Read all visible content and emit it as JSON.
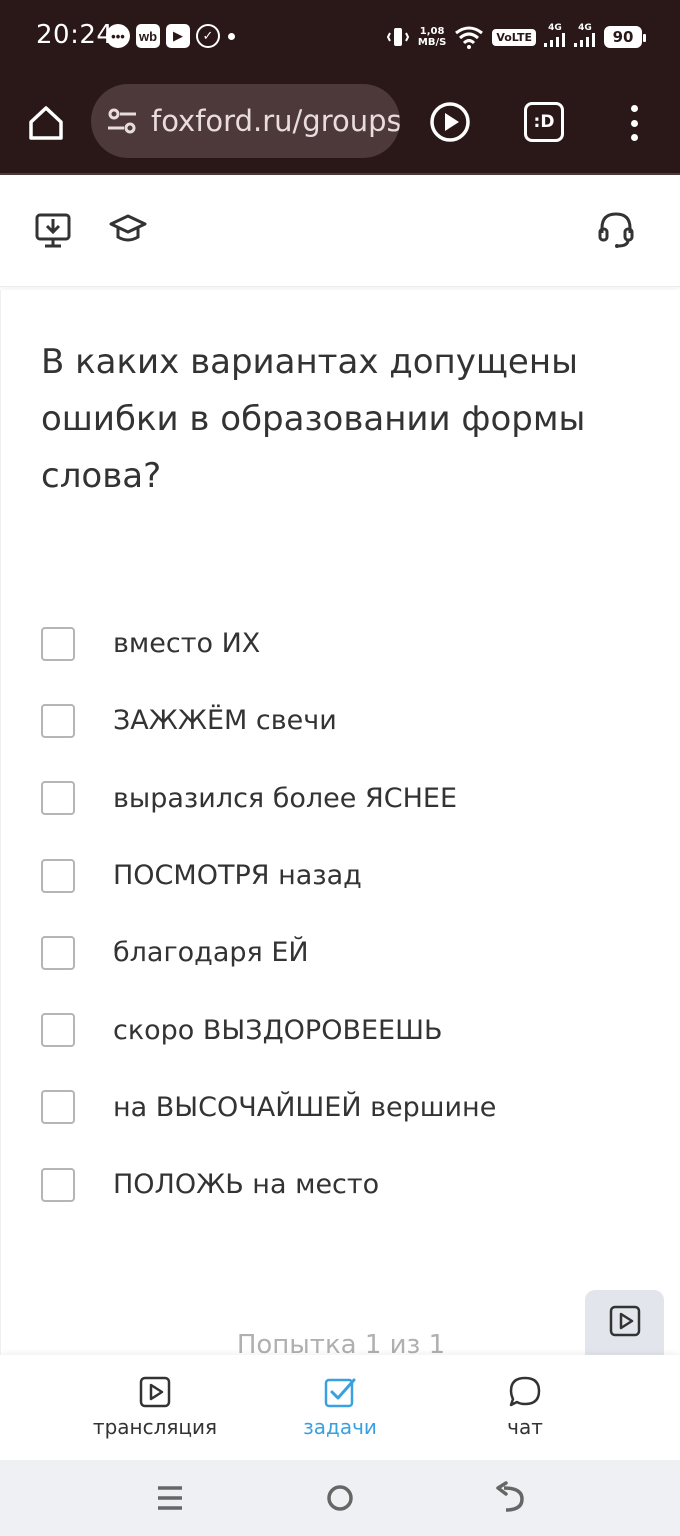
{
  "status_bar": {
    "time": "20:24",
    "left_icons": [
      "chat-bubble-icon",
      "wb-icon",
      "youtube-icon",
      "check-circle-icon"
    ],
    "net_speed_value": "1,08",
    "net_speed_unit": "MB/S",
    "volte": "VoLTE",
    "sim1_label": "4G",
    "sim2_label": "4G",
    "battery": "90"
  },
  "browser": {
    "url": "foxford.ru/groups"
  },
  "question": {
    "text": "В каких вариантах допущены ошибки в образовании формы слова?"
  },
  "options": [
    {
      "label": "вместо ИХ",
      "checked": false
    },
    {
      "label": "ЗАЖЖЁМ свечи",
      "checked": false
    },
    {
      "label": "выразился более ЯСНЕЕ",
      "checked": false
    },
    {
      "label": "ПОСМОТРЯ назад",
      "checked": false
    },
    {
      "label": "благодаря ЕЙ",
      "checked": false
    },
    {
      "label": "скоро ВЫЗДОРОВЕЕШЬ",
      "checked": false
    },
    {
      "label": "на ВЫСОЧАЙШЕЙ вершине",
      "checked": false
    },
    {
      "label": "ПОЛОЖЬ на место",
      "checked": false
    }
  ],
  "attempt_text": "Попытка 1 из 1",
  "bottom_nav": [
    {
      "label": "трансляция",
      "icon": "play-square-icon",
      "active": false
    },
    {
      "label": "задачи",
      "icon": "check-square-icon",
      "active": true
    },
    {
      "label": "чат",
      "icon": "chat-bubble-icon",
      "active": false
    }
  ],
  "colors": {
    "browser_bg": "#2a1717",
    "accent": "#3aa0e0",
    "text": "#333333"
  }
}
